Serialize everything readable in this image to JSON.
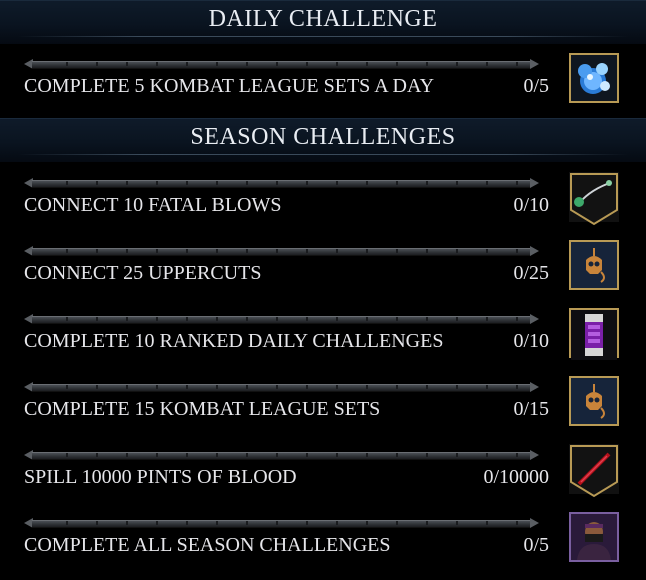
{
  "daily": {
    "title": "DAILY CHALLENGE",
    "items": [
      {
        "label": "COMPLETE 5 KOMBAT LEAGUE SETS A DAY",
        "count": "0/5",
        "progress": 0,
        "reward_icon": "koins-orbs-icon"
      }
    ]
  },
  "season": {
    "title": "SEASON CHALLENGES",
    "items": [
      {
        "label": "CONNECT 10 FATAL BLOWS",
        "count": "0/10",
        "progress": 0,
        "reward_icon": "kunai-shield-icon"
      },
      {
        "label": "CONNECT 25 UPPERCUTS",
        "count": "0/25",
        "progress": 0,
        "reward_icon": "skull-hook-icon"
      },
      {
        "label": "COMPLETE 10 RANKED DAILY CHALLENGES",
        "count": "0/10",
        "progress": 0,
        "reward_icon": "consumable-canister-icon"
      },
      {
        "label": "COMPLETE 15 KOMBAT LEAGUE SETS",
        "count": "0/15",
        "progress": 0,
        "reward_icon": "skull-hook-icon"
      },
      {
        "label": "SPILL 10000 PINTS OF BLOOD",
        "count": "0/10000",
        "progress": 0,
        "reward_icon": "blood-blade-shield-icon"
      },
      {
        "label": "COMPLETE ALL SEASON CHALLENGES",
        "count": "0/5",
        "progress": 0,
        "reward_icon": "character-skin-icon"
      }
    ]
  },
  "colors": {
    "header_bg": "#0a1420",
    "accent_gold": "#b89a55",
    "text": "#e6e6ea"
  }
}
